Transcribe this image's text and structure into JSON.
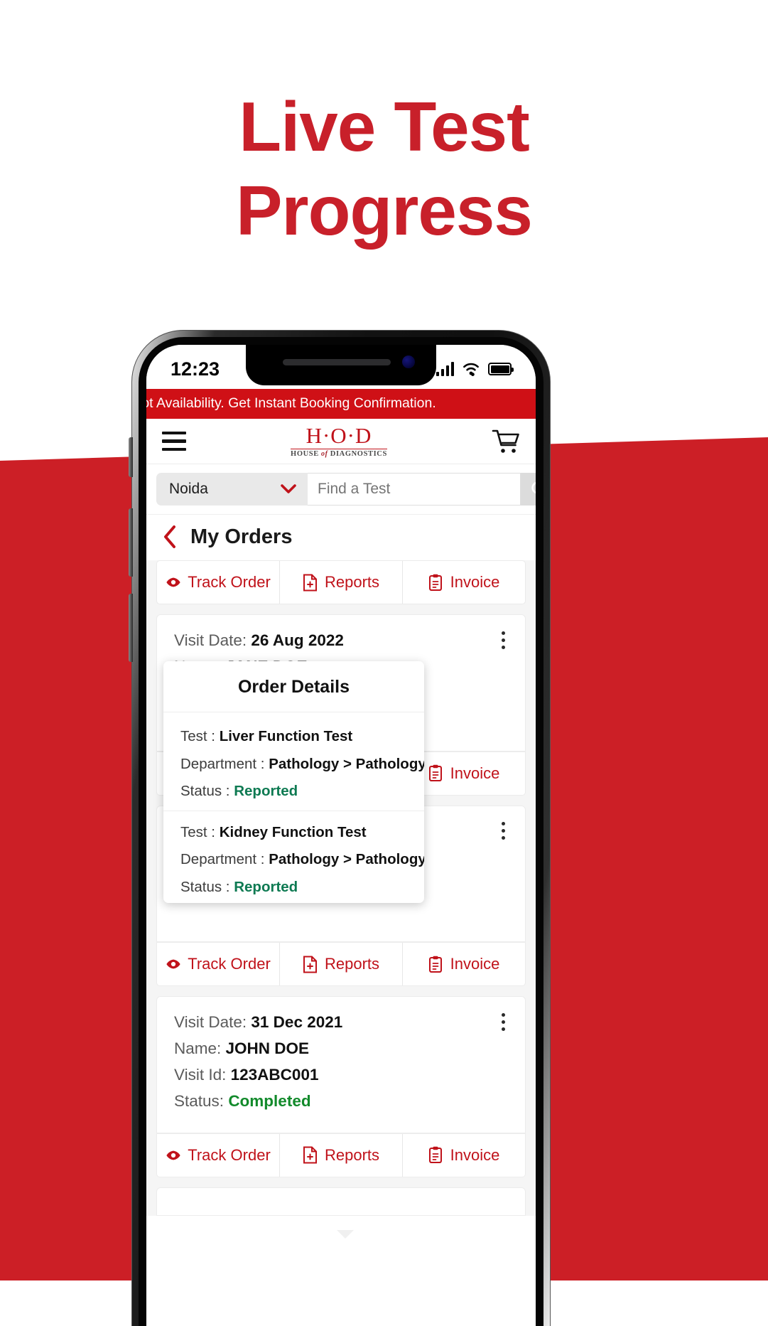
{
  "promo": {
    "title_line1": "Live Test",
    "title_line2": "Progress",
    "accent_color": "#c8202a",
    "band_color": "#cc1f26"
  },
  "phone": {
    "status_bar": {
      "time": "12:23",
      "signal_icon": "cellular-bars-icon",
      "wifi_icon": "wifi-icon",
      "battery_icon": "battery-full-icon"
    }
  },
  "app": {
    "promo_ticker": "Slot Availability. Get Instant Booking Confirmation.",
    "navbar": {
      "menu_icon": "hamburger-menu-icon",
      "logo_main": "H·O·D",
      "logo_sub_a": "HOUSE ",
      "logo_sub_b": "of",
      "logo_sub_c": " DIAGNOSTICS",
      "cart_icon": "shopping-cart-icon"
    },
    "search": {
      "city": "Noida",
      "city_chevron_icon": "chevron-down-icon",
      "placeholder": "Find a Test",
      "value": "",
      "search_icon": "search-icon"
    },
    "page": {
      "back_icon": "chevron-left-icon",
      "title": "My Orders"
    },
    "actions": {
      "track_order": "Track Order",
      "track_order_icon": "eye-icon",
      "reports": "Reports",
      "reports_icon": "file-add-icon",
      "invoice": "Invoice",
      "invoice_icon": "clipboard-icon"
    },
    "labels": {
      "visit_date": "Visit Date:",
      "name": "Name:",
      "visit_id": "Visit Id:",
      "status": "Status:",
      "kebab_icon": "more-vertical-icon"
    },
    "orders": [
      {
        "visit_date": "26 Aug 2022",
        "name": "JANE DOE",
        "visit_id": "",
        "status": ""
      },
      {
        "visit_date": "",
        "name": "",
        "visit_id": "",
        "status": ""
      },
      {
        "visit_date": "31 Dec 2021",
        "name": "JOHN DOE",
        "visit_id": "123ABC001",
        "status": "Completed"
      }
    ],
    "popup": {
      "title": "Order Details",
      "label_test": "Test :",
      "label_department": "Department :",
      "label_status": "Status :",
      "items": [
        {
          "test": "Liver Function Test",
          "department": "Pathology > Pathology",
          "status": "Reported"
        },
        {
          "test": "Kidney Function Test",
          "department": "Pathology > Pathology",
          "status": "Reported"
        }
      ]
    },
    "colors": {
      "brand_red": "#c0121a",
      "promo_red": "#cf1016",
      "status_green": "#128a2b",
      "reported_green": "#0e7a52"
    }
  }
}
